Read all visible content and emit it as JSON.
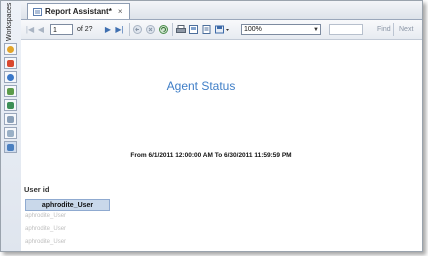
{
  "rail": {
    "label": "Workspaces"
  },
  "tab": {
    "label": "Report Assistant*",
    "close": "×"
  },
  "toolbar": {
    "first": "|◀",
    "prev": "◀",
    "page_value": "1",
    "of_pages": "of 2?",
    "next": "▶",
    "last": "▶|",
    "zoom_value": "100%",
    "find_label": "Find",
    "next_label": "Next"
  },
  "report": {
    "title": "Agent Status",
    "date_range": "From 6/1/2011 12:00:00 AM  To 6/30/2011 11:59:59 PM",
    "user_id_header": "User id",
    "selected_user": "aphrodite_User",
    "user_rows": [
      "aphrodite_User",
      "aphrodite_User",
      "aphrodite_User"
    ]
  }
}
